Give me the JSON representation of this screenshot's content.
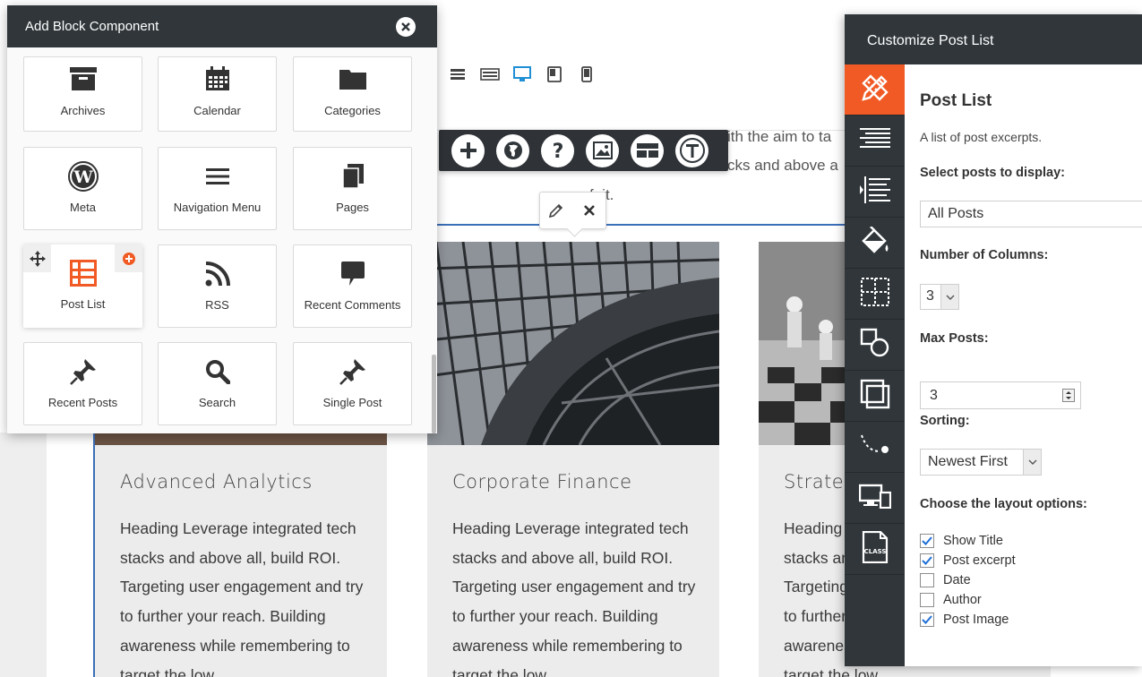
{
  "add_block": {
    "title": "Add Block Component",
    "items": [
      {
        "label": "Archives",
        "icon": "archive-icon"
      },
      {
        "label": "Calendar",
        "icon": "calendar-icon"
      },
      {
        "label": "Categories",
        "icon": "folder-icon"
      },
      {
        "label": "Meta",
        "icon": "wordpress-icon"
      },
      {
        "label": "Navigation Menu",
        "icon": "menu-icon"
      },
      {
        "label": "Pages",
        "icon": "pages-icon"
      },
      {
        "label": "Post List",
        "icon": "post-list-icon",
        "active": true
      },
      {
        "label": "RSS",
        "icon": "rss-icon"
      },
      {
        "label": "Recent Comments",
        "icon": "comment-icon"
      },
      {
        "label": "Recent Posts",
        "icon": "pin-icon"
      },
      {
        "label": "Search",
        "icon": "search-icon"
      },
      {
        "label": "Single Post",
        "icon": "pin-icon"
      }
    ]
  },
  "page": {
    "intro_lines": [
      "ith the aim to ta",
      "cks and above a",
      "fuit."
    ],
    "cards": [
      {
        "title": "Advanced Analytics",
        "text": "Heading Leverage integrated tech stacks and above all, build ROI. Targeting user engagement and try to further your reach. Building awareness while remembering to target the low"
      },
      {
        "title": "Corporate Finance",
        "text": "Heading Leverage integrated tech stacks and above all, build ROI. Targeting user engagement and try to further your reach. Building awareness while remembering to target the low"
      },
      {
        "title": "Strateg",
        "text": "Heading Leverage integrated tech stacks and above all, build ROI. Targeting user engagement and try to further your reach. Building awareness while remembering to target the low"
      }
    ]
  },
  "customize": {
    "title": "Customize Post List",
    "heading": "Post List",
    "description": "A list of post excerpts.",
    "select_label": "Select posts to display:",
    "select_value": "All Posts",
    "columns_label": "Number of Columns:",
    "columns_value": "3",
    "max_label": "Max Posts:",
    "max_value": "3",
    "sorting_label": "Sorting:",
    "sorting_value": "Newest First",
    "layout_label": "Choose the layout options:",
    "options": [
      {
        "label": "Show Title",
        "checked": true
      },
      {
        "label": "Post excerpt",
        "checked": true
      },
      {
        "label": "Date",
        "checked": false
      },
      {
        "label": "Author",
        "checked": false
      },
      {
        "label": "Post Image",
        "checked": true
      }
    ]
  },
  "colors": {
    "accent": "#f15a24",
    "dark": "#30363a",
    "selection": "#3b6fb8"
  }
}
